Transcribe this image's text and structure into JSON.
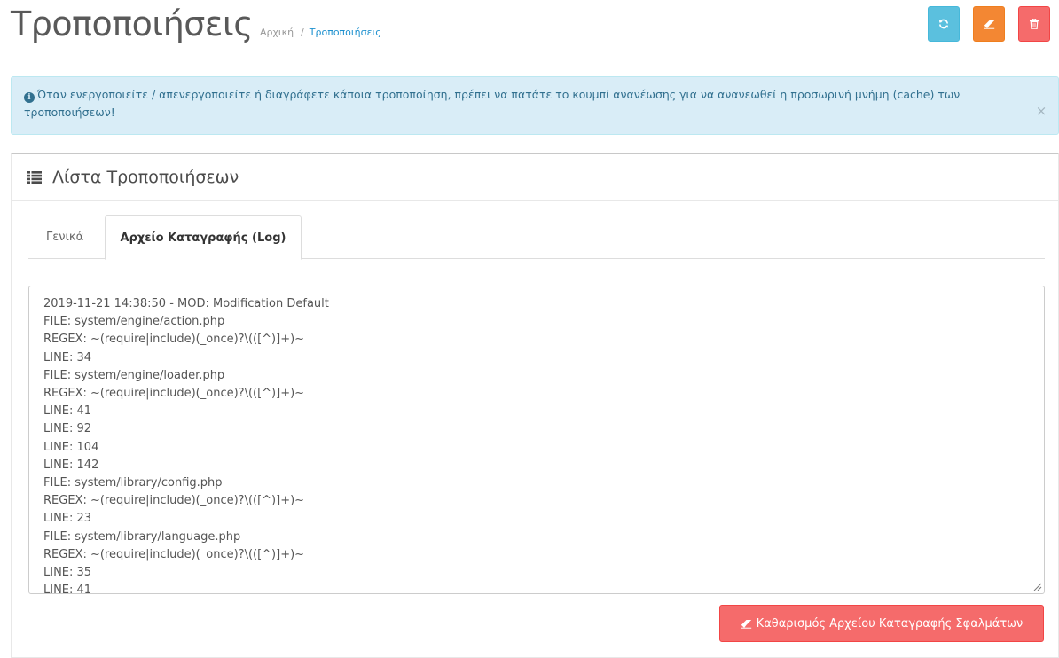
{
  "header": {
    "title": "Τροποποιήσεις",
    "breadcrumb": [
      {
        "label": "Αρχική"
      },
      {
        "label": "Τροποποιήσεις"
      }
    ],
    "breadcrumb_separator": "/",
    "buttons": [
      {
        "name": "refresh-button",
        "icon": "refresh-icon",
        "color": "#5bc0de"
      },
      {
        "name": "clear-button",
        "icon": "eraser-icon",
        "color": "#f38733"
      },
      {
        "name": "delete-button",
        "icon": "trash-icon",
        "color": "#f56b6b"
      }
    ]
  },
  "alert": {
    "icon": "info-circle-icon",
    "text": "Όταν ενεργοποιείτε / απενεργοποιείτε ή διαγράφετε κάποια τροποποίηση, πρέπει να πατάτε το κουμπί ανανέωσης για να ανανεωθεί η προσωρινή μνήμη (cache) των τροποποιήσεων!",
    "close": "×"
  },
  "panel": {
    "icon": "list-icon",
    "title": "Λίστα Τροποποιήσεων",
    "tabs": [
      {
        "label": "Γενικά",
        "active": false
      },
      {
        "label": "Αρχείο Καταγραφής (Log)",
        "active": true
      }
    ],
    "log_lines": [
      "2019-11-21 14:38:50 - MOD: Modification Default",
      "FILE: system/engine/action.php",
      "REGEX: ~(require|include)(_once)?\\(([^)]+)~",
      "LINE: 34",
      "FILE: system/engine/loader.php",
      "REGEX: ~(require|include)(_once)?\\(([^)]+)~",
      "LINE: 41",
      "LINE: 92",
      "LINE: 104",
      "LINE: 142",
      "FILE: system/library/config.php",
      "REGEX: ~(require|include)(_once)?\\(([^)]+)~",
      "LINE: 23",
      "FILE: system/library/language.php",
      "REGEX: ~(require|include)(_once)?\\(([^)]+)~",
      "LINE: 35",
      "LINE: 41"
    ],
    "clear_log_button": {
      "icon": "eraser-icon",
      "label": "Καθαρισμός Αρχείου Καταγραφής Σφαλμάτων"
    }
  }
}
